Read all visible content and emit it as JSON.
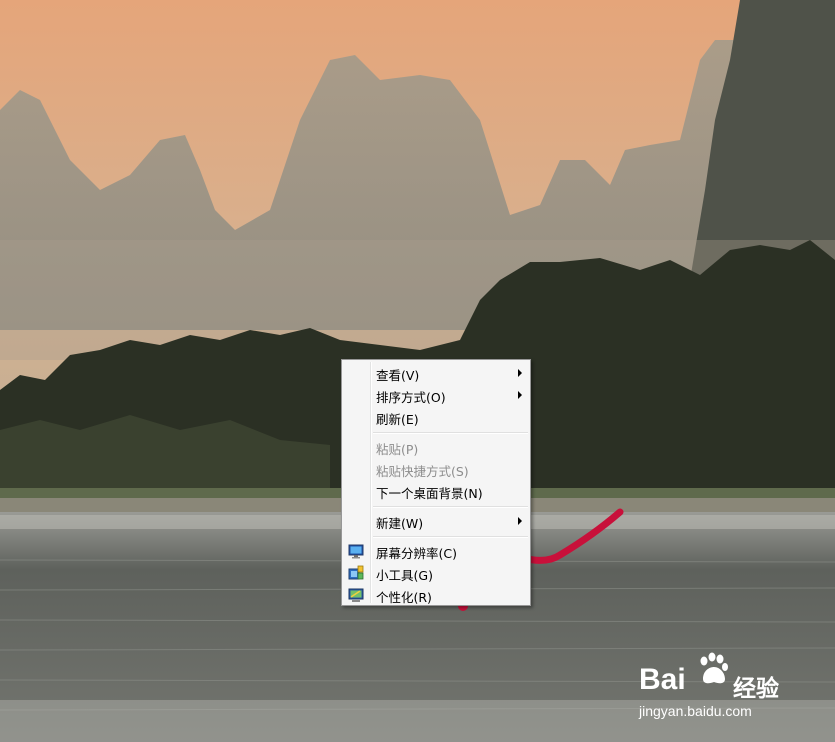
{
  "context_menu": {
    "items": [
      {
        "label": "查看(V)",
        "submenu": true,
        "enabled": true
      },
      {
        "label": "排序方式(O)",
        "submenu": true,
        "enabled": true
      },
      {
        "label": "刷新(E)",
        "submenu": false,
        "enabled": true
      },
      {
        "label": "粘贴(P)",
        "submenu": false,
        "enabled": false
      },
      {
        "label": "粘贴快捷方式(S)",
        "submenu": false,
        "enabled": false
      },
      {
        "label": "下一个桌面背景(N)",
        "submenu": false,
        "enabled": true
      },
      {
        "label": "新建(W)",
        "submenu": true,
        "enabled": true
      },
      {
        "label": "屏幕分辨率(C)",
        "submenu": false,
        "enabled": true,
        "icon": "display-settings-icon"
      },
      {
        "label": "小工具(G)",
        "submenu": false,
        "enabled": true,
        "icon": "gadgets-icon"
      },
      {
        "label": "个性化(R)",
        "submenu": false,
        "enabled": true,
        "icon": "personalize-icon"
      }
    ]
  },
  "watermark": {
    "brand": "Bai",
    "brand_cn": "经验",
    "url": "jingyan.baidu.com"
  },
  "colors": {
    "sky_top": "#e6a77d",
    "sky_bottom": "#d3b896",
    "mountain": "#8c877a",
    "trees": "#2a2f23",
    "water": "#6d706b",
    "annotation": "#c8103a",
    "menu_bg": "#f5f5f5"
  }
}
